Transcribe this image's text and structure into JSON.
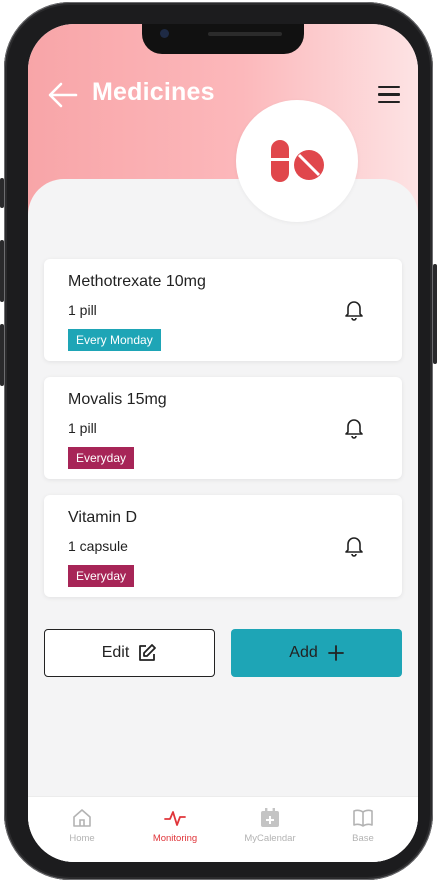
{
  "header": {
    "title": "Medicines"
  },
  "colors": {
    "header_start": "#f8a5a8",
    "header_end": "#fde3e4",
    "pill_red": "#e0474c",
    "accent_teal": "#1ea5b6",
    "tag_monday": "#1ea5b6",
    "tag_everyday": "#a72557",
    "tab_active": "#e0353a",
    "tab_inactive": "#b3b3b3"
  },
  "icons": {
    "back": "arrow-left-icon",
    "menu": "hamburger-menu-icon",
    "badge": "pills-icon",
    "reminder": "bell-icon",
    "edit": "edit-icon",
    "add": "plus-icon"
  },
  "medicines": [
    {
      "name": "Methotrexate 10mg",
      "dose": "1 pill",
      "frequency": "Every Monday"
    },
    {
      "name": "Movalis 15mg",
      "dose": "1 pill",
      "frequency": "Everyday"
    },
    {
      "name": "Vitamin D",
      "dose": "1 capsule",
      "frequency": "Everyday"
    }
  ],
  "actions": {
    "edit_label": "Edit",
    "add_label": "Add"
  },
  "tabs": [
    {
      "label": "Home",
      "icon": "home-icon",
      "active": false
    },
    {
      "label": "Monitoring",
      "icon": "pulse-icon",
      "active": true
    },
    {
      "label": "MyCalendar",
      "icon": "calendar-plus-icon",
      "active": false
    },
    {
      "label": "Base",
      "icon": "book-icon",
      "active": false
    }
  ]
}
